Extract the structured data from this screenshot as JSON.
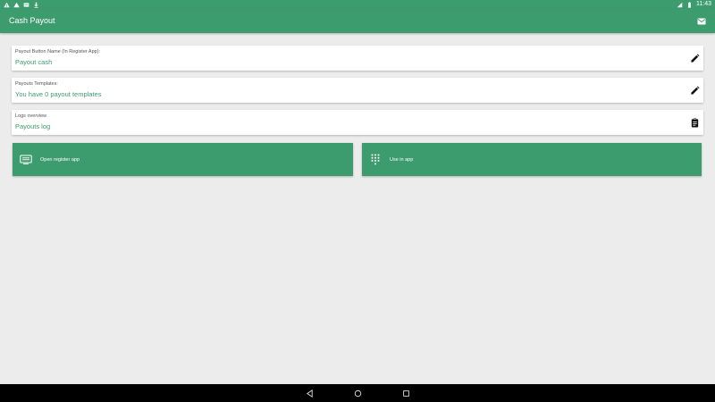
{
  "status_bar": {
    "time": "11:43",
    "left_icons": [
      "warning-icon",
      "alert-icon",
      "sd-card-icon",
      "download-icon"
    ],
    "right_icons": [
      "wifi-icon",
      "battery-icon"
    ]
  },
  "app_bar": {
    "title": "Cash Payout",
    "action_icon": "mail-icon"
  },
  "cards": [
    {
      "label": "Payout Button Name (In Register App):",
      "value": "Payout cash",
      "action_icon": "edit-icon"
    },
    {
      "label": "Payouts Templates:",
      "value": "You have 0 payout templates",
      "action_icon": "edit-icon"
    },
    {
      "label": "Logs overview",
      "value": "Payouts log",
      "action_icon": "clipboard-icon"
    }
  ],
  "buttons": {
    "open_register": {
      "label": "Open register app",
      "icon": "register-icon"
    },
    "use_in_app": {
      "label": "Use in app",
      "icon": "dialpad-icon"
    }
  },
  "nav_bar": {
    "icons": [
      "back-icon",
      "home-icon",
      "recents-icon"
    ]
  },
  "colors": {
    "primary": "#3d9c6e",
    "background": "#ececec",
    "card": "#ffffff",
    "nav_bar": "#000000"
  }
}
